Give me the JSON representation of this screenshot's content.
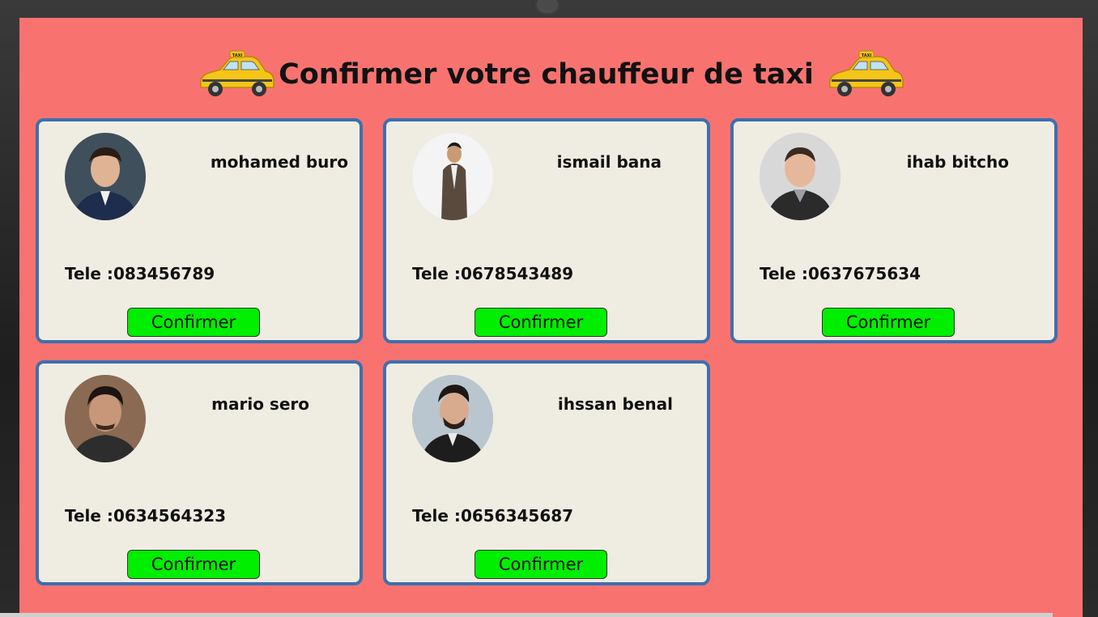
{
  "page": {
    "title": "Confirmer votre chauffeur de taxi",
    "taxi_icon_label": "TAXI",
    "background_color": "#f87370",
    "card_border_color": "#3e6fb0",
    "button_color": "#00ee00"
  },
  "drivers": [
    {
      "name": "mohamed buro",
      "phone_label": "Tele :",
      "phone": "083456789",
      "button": "Confirmer"
    },
    {
      "name": "ismail bana",
      "phone_label": "Tele :",
      "phone": "0678543489",
      "button": "Confirmer"
    },
    {
      "name": "ihab bitcho",
      "phone_label": "Tele :",
      "phone": "0637675634",
      "button": "Confirmer"
    },
    {
      "name": "mario sero",
      "phone_label": "Tele :",
      "phone": "0634564323",
      "button": "Confirmer"
    },
    {
      "name": "ihssan benal",
      "phone_label": "Tele :",
      "phone": "0656345687",
      "button": "Confirmer"
    }
  ]
}
